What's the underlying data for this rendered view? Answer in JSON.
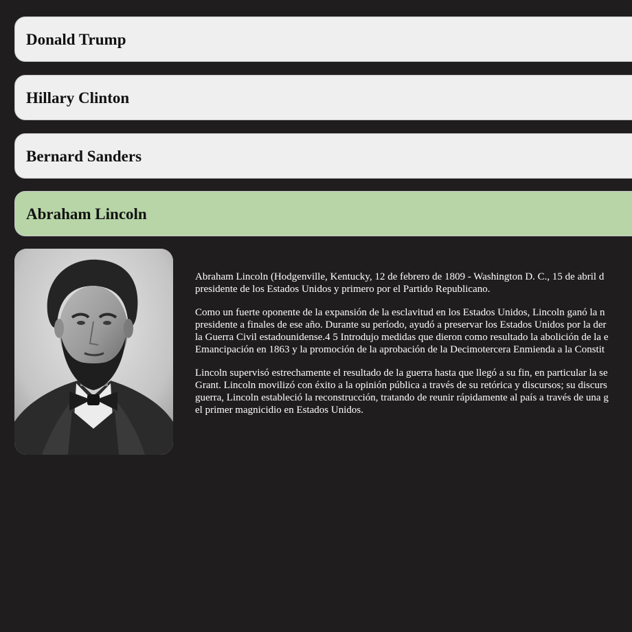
{
  "accordion": [
    {
      "name": "Donald Trump",
      "active": false
    },
    {
      "name": "Hillary Clinton",
      "active": false
    },
    {
      "name": "Bernard Sanders",
      "active": false
    },
    {
      "name": "Abraham Lincoln",
      "active": true
    }
  ],
  "colors": {
    "page_background": "#1f1d1e",
    "accordion_background": "#efefef",
    "accordion_active_background": "#b7d5a7",
    "bio_text": "#ffffff"
  },
  "panel": {
    "image_icon": "portrait-photo",
    "paragraphs": [
      {
        "lines": [
          "Abraham Lincoln (Hodgenville, Kentucky, 12 de febrero de 1809 - Washington D. C., 15 de abril d",
          "presidente de los Estados Unidos y primero por el Partido Republicano."
        ]
      },
      {
        "lines": [
          "Como un fuerte oponente de la expansión de la esclavitud en los Estados Unidos, Lincoln ganó la n",
          "presidente a finales de ese año. Durante su período, ayudó a preservar los Estados Unidos por la der",
          "la Guerra Civil estadounidense.4 5 Introdujo medidas que dieron como resultado la abolición de la e",
          "Emancipación en 1863 y la promoción de la aprobación de la Decimotercera Enmienda a la Constit"
        ]
      },
      {
        "lines": [
          "Lincoln supervisó estrechamente el resultado de la guerra hasta que llegó a su fin, en particular la se",
          "Grant. Lincoln movilizó con éxito a la opinión pública a través de su retórica y discursos; su discurs",
          "guerra, Lincoln estableció la reconstrucción, tratando de reunir rápidamente al país a través de una g",
          "el primer magnicidio en Estados Unidos."
        ]
      }
    ]
  }
}
